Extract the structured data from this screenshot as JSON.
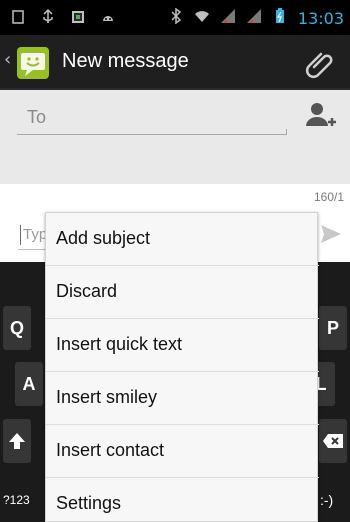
{
  "status_bar": {
    "time": "13:03",
    "icons": [
      "screenshot-icon",
      "usb-icon",
      "sim-card-icon",
      "android-debug-icon",
      "bluetooth-icon",
      "wifi-icon",
      "signal-icon",
      "signal-icon-2",
      "battery-icon"
    ]
  },
  "action_bar": {
    "title": "New message",
    "back_icon": "chevron-left-icon",
    "app_icon": "messaging-app-icon",
    "attach_icon": "paperclip-icon"
  },
  "compose": {
    "to_placeholder": "To",
    "message_placeholder": "Type message",
    "character_counter": "160/1"
  },
  "keyboard_visible": {
    "q": "Q",
    "p": "P",
    "a": "A",
    "l": "L",
    "shift": "shift-icon",
    "backspace": "backspace-icon",
    "symbols": "?123",
    "emoticon": ":-)"
  },
  "menu": {
    "items": [
      {
        "label": "Add subject"
      },
      {
        "label": "Discard"
      },
      {
        "label": "Insert quick text"
      },
      {
        "label": "Insert smiley"
      },
      {
        "label": "Insert contact"
      },
      {
        "label": "Settings"
      }
    ]
  },
  "colors": {
    "accent": "#33b5e5",
    "app_green": "#97c024",
    "actionbar": "#1f1f1f",
    "recipients_bg": "#e9e9e9",
    "menu_bg": "#f7f7f7"
  }
}
